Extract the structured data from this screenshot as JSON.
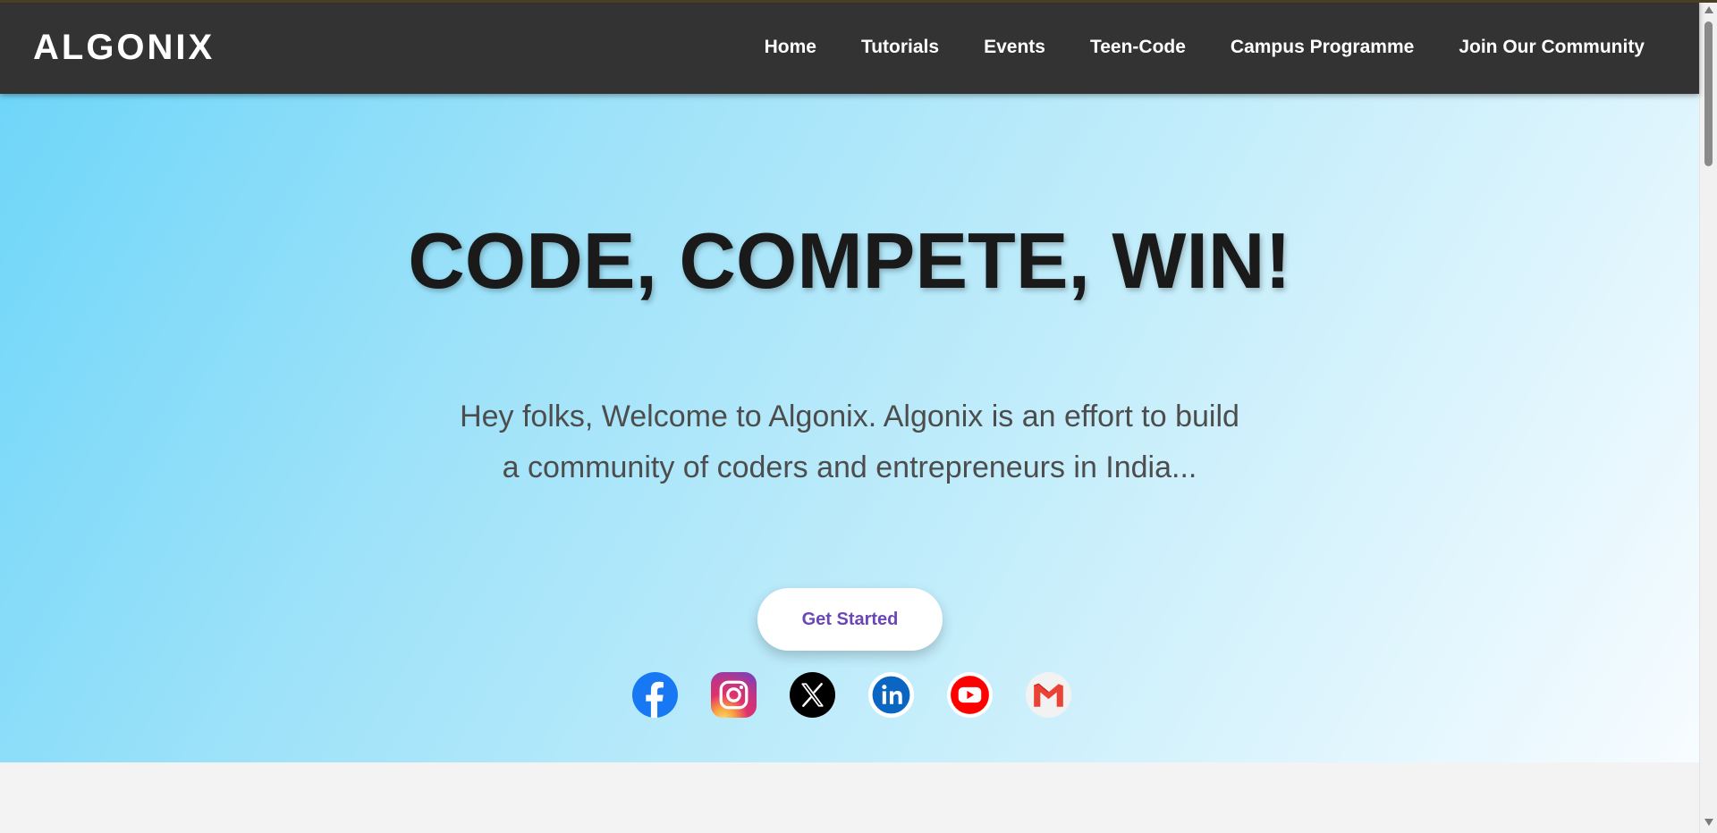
{
  "nav": {
    "logo": "ALGONIX",
    "links": [
      "Home",
      "Tutorials",
      "Events",
      "Teen-Code",
      "Campus Programme",
      "Join Our Community"
    ]
  },
  "hero": {
    "headline": "CODE, COMPETE, WIN!",
    "intro": "Hey folks, Welcome to Algonix. Algonix is an effort to build a community of coders and entrepreneurs in India...",
    "cta_label": "Get Started"
  },
  "socials": [
    "facebook-icon",
    "instagram-icon",
    "x-icon",
    "linkedin-icon",
    "youtube-icon",
    "gmail-icon"
  ],
  "colors": {
    "navbar": "#333333",
    "hero_gradient_start": "#6fd6f9",
    "hero_gradient_end": "#f7fcff",
    "cta_text": "#6c46b8",
    "facebook": "#1877f2",
    "youtube": "#ff0000",
    "linkedin": "#0a66c2",
    "gmail": "#ea4335"
  }
}
